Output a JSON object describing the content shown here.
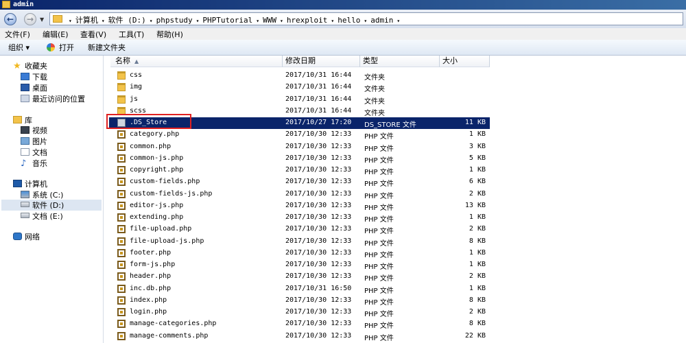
{
  "window": {
    "title": "admin"
  },
  "address": {
    "crumbs": [
      "计算机",
      "软件 (D:)",
      "phpstudy",
      "PHPTutorial",
      "WWW",
      "hrexploit",
      "hello",
      "admin"
    ]
  },
  "menu": {
    "file": "文件(F)",
    "edit": "编辑(E)",
    "view": "查看(V)",
    "tools": "工具(T)",
    "help": "帮助(H)"
  },
  "toolbar": {
    "organize": "组织 ▾",
    "open": "打开",
    "new_folder": "新建文件夹"
  },
  "nav": {
    "favorites": "收藏夹",
    "downloads": "下载",
    "desktop": "桌面",
    "recent": "最近访问的位置",
    "libraries": "库",
    "videos": "视频",
    "pictures": "图片",
    "documents": "文档",
    "music": "音乐",
    "computer": "计算机",
    "drive_c": "系统 (C:)",
    "drive_d": "软件 (D:)",
    "drive_e": "文档 (E:)",
    "network": "网络"
  },
  "columns": {
    "name": "名称",
    "date": "修改日期",
    "type": "类型",
    "size": "大小"
  },
  "files": [
    {
      "name": "css",
      "date": "2017/10/31 16:44",
      "type": "文件夹",
      "size": "",
      "kind": "folder"
    },
    {
      "name": "img",
      "date": "2017/10/31 16:44",
      "type": "文件夹",
      "size": "",
      "kind": "folder"
    },
    {
      "name": "js",
      "date": "2017/10/31 16:44",
      "type": "文件夹",
      "size": "",
      "kind": "folder"
    },
    {
      "name": "scss",
      "date": "2017/10/31 16:44",
      "type": "文件夹",
      "size": "",
      "kind": "folder"
    },
    {
      "name": ".DS_Store",
      "date": "2017/10/27 17:20",
      "type": "DS_STORE 文件",
      "size": "11 KB",
      "kind": "blank",
      "selected": true
    },
    {
      "name": "category.php",
      "date": "2017/10/30 12:33",
      "type": "PHP 文件",
      "size": "1 KB",
      "kind": "php"
    },
    {
      "name": "common.php",
      "date": "2017/10/30 12:33",
      "type": "PHP 文件",
      "size": "3 KB",
      "kind": "php"
    },
    {
      "name": "common-js.php",
      "date": "2017/10/30 12:33",
      "type": "PHP 文件",
      "size": "5 KB",
      "kind": "php"
    },
    {
      "name": "copyright.php",
      "date": "2017/10/30 12:33",
      "type": "PHP 文件",
      "size": "1 KB",
      "kind": "php"
    },
    {
      "name": "custom-fields.php",
      "date": "2017/10/30 12:33",
      "type": "PHP 文件",
      "size": "6 KB",
      "kind": "php"
    },
    {
      "name": "custom-fields-js.php",
      "date": "2017/10/30 12:33",
      "type": "PHP 文件",
      "size": "2 KB",
      "kind": "php"
    },
    {
      "name": "editor-js.php",
      "date": "2017/10/30 12:33",
      "type": "PHP 文件",
      "size": "13 KB",
      "kind": "php"
    },
    {
      "name": "extending.php",
      "date": "2017/10/30 12:33",
      "type": "PHP 文件",
      "size": "1 KB",
      "kind": "php"
    },
    {
      "name": "file-upload.php",
      "date": "2017/10/30 12:33",
      "type": "PHP 文件",
      "size": "2 KB",
      "kind": "php"
    },
    {
      "name": "file-upload-js.php",
      "date": "2017/10/30 12:33",
      "type": "PHP 文件",
      "size": "8 KB",
      "kind": "php"
    },
    {
      "name": "footer.php",
      "date": "2017/10/30 12:33",
      "type": "PHP 文件",
      "size": "1 KB",
      "kind": "php"
    },
    {
      "name": "form-js.php",
      "date": "2017/10/30 12:33",
      "type": "PHP 文件",
      "size": "1 KB",
      "kind": "php"
    },
    {
      "name": "header.php",
      "date": "2017/10/30 12:33",
      "type": "PHP 文件",
      "size": "2 KB",
      "kind": "php"
    },
    {
      "name": "inc.db.php",
      "date": "2017/10/31 16:50",
      "type": "PHP 文件",
      "size": "1 KB",
      "kind": "php"
    },
    {
      "name": "index.php",
      "date": "2017/10/30 12:33",
      "type": "PHP 文件",
      "size": "8 KB",
      "kind": "php"
    },
    {
      "name": "login.php",
      "date": "2017/10/30 12:33",
      "type": "PHP 文件",
      "size": "2 KB",
      "kind": "php"
    },
    {
      "name": "manage-categories.php",
      "date": "2017/10/30 12:33",
      "type": "PHP 文件",
      "size": "8 KB",
      "kind": "php"
    },
    {
      "name": "manage-comments.php",
      "date": "2017/10/30 12:33",
      "type": "PHP 文件",
      "size": "22 KB",
      "kind": "php"
    }
  ],
  "colors": {
    "selection": "#0a246a",
    "highlight_box": "#e02020"
  }
}
